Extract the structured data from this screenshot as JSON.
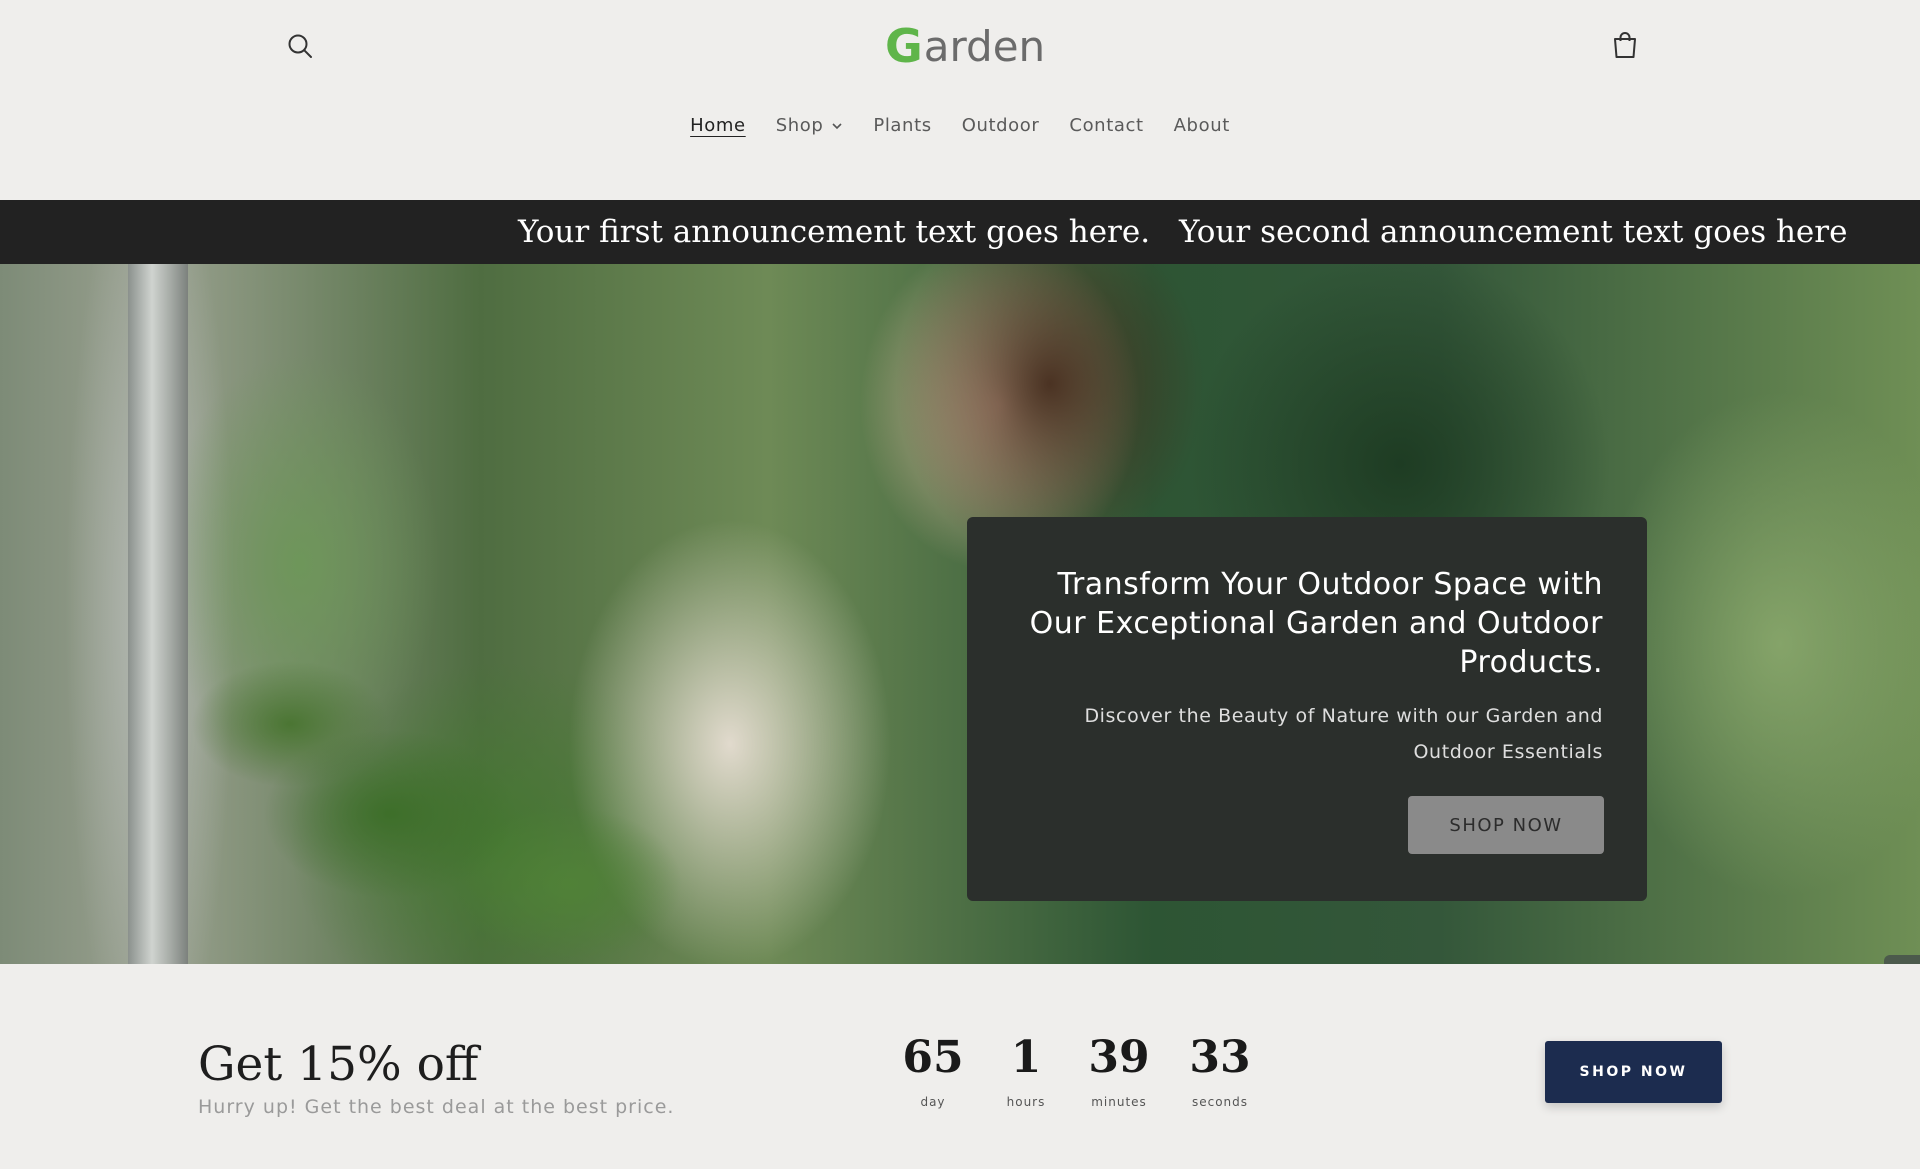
{
  "header": {
    "logo": {
      "first_letter": "G",
      "rest": "arden"
    },
    "nav": [
      {
        "label": "Home",
        "active": true
      },
      {
        "label": "Shop",
        "has_dropdown": true
      },
      {
        "label": "Plants"
      },
      {
        "label": "Outdoor"
      },
      {
        "label": "Contact"
      },
      {
        "label": "About"
      }
    ],
    "icons": {
      "search": "search-icon",
      "cart": "cart-icon",
      "dropdown": "chevron-down-icon"
    }
  },
  "announcement": {
    "first": "Your first announcement text goes here.",
    "second": "Your second announcement text goes here"
  },
  "hero": {
    "heading": "Transform Your Outdoor Space with Our Exceptional Garden and Outdoor Products.",
    "subheading": "Discover the Beauty of Nature with our Garden and Outdoor Essentials",
    "cta_label": "SHOP NOW",
    "side_badge_icon": "collapse-icon"
  },
  "promo": {
    "title": "Get 15% off",
    "subtitle": "Hurry up! Get the best deal at the best price.",
    "countdown": {
      "day": {
        "value": "65",
        "label": "day"
      },
      "hours": {
        "value": "1",
        "label": "hours"
      },
      "minutes": {
        "value": "39",
        "label": "minutes"
      },
      "seconds": {
        "value": "33",
        "label": "seconds"
      }
    },
    "cta_label": "SHOP NOW"
  },
  "colors": {
    "background": "#efeeec",
    "logo_accent": "#5fb54a",
    "announcement_bg": "#222222",
    "hero_card_bg": "#2b2f2c",
    "promo_button_bg": "#1c2c4f"
  }
}
